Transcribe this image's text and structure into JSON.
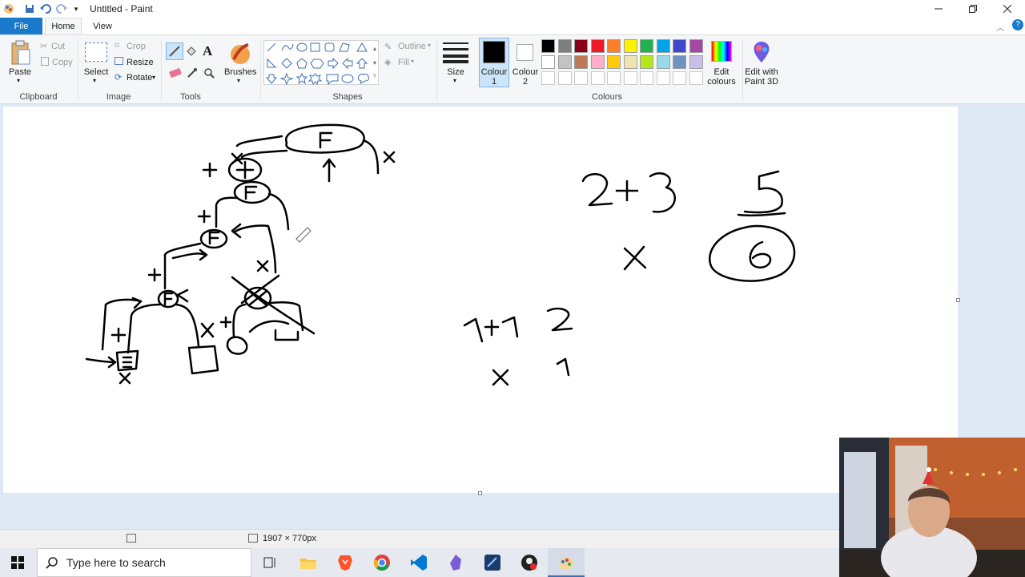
{
  "window": {
    "title": "Untitled - Paint",
    "controls": [
      "minimize",
      "restore",
      "close"
    ]
  },
  "quick_access": [
    "save-icon",
    "undo-icon",
    "redo-icon",
    "customize-icon"
  ],
  "tabs": [
    {
      "label": "File",
      "active": false
    },
    {
      "label": "Home",
      "active": true
    },
    {
      "label": "View",
      "active": false
    }
  ],
  "ribbon": {
    "clipboard": {
      "group": "Clipboard",
      "paste": "Paste",
      "cut": "Cut",
      "copy": "Copy"
    },
    "image": {
      "group": "Image",
      "select": "Select",
      "crop": "Crop",
      "resize": "Resize",
      "rotate": "Rotate"
    },
    "tools": {
      "group": "Tools"
    },
    "brushes": {
      "label": "Brushes"
    },
    "shapes": {
      "group": "Shapes",
      "outline": "Outline",
      "fill": "Fill"
    },
    "size": {
      "label": "Size"
    },
    "colour1": {
      "label": "Colour 1",
      "value": "#000000"
    },
    "colour2": {
      "label": "Colour 2",
      "value": "#ffffff"
    },
    "colours": {
      "group": "Colours",
      "edit": "Edit colours"
    },
    "paint3d": {
      "label": "Edit with Paint 3D"
    }
  },
  "palette_row1": [
    "#000000",
    "#7f7f7f",
    "#880015",
    "#ed1c24",
    "#ff7f27",
    "#fff200",
    "#22b14c",
    "#00a2e8",
    "#3f48cc",
    "#a349a4"
  ],
  "palette_row2": [
    "#ffffff",
    "#c3c3c3",
    "#b97a57",
    "#ffaec9",
    "#ffc90e",
    "#efe4b0",
    "#b5e61d",
    "#99d9ea",
    "#7092be",
    "#c8bfe7"
  ],
  "status": {
    "dimensions": "1907 × 770px"
  },
  "taskbar": {
    "search_placeholder": "Type here to search",
    "apps": [
      "task-view-icon",
      "file-explorer-icon",
      "brave-icon",
      "chrome-icon",
      "vscode-icon",
      "obsidian-icon",
      "app-icon",
      "app-icon",
      "paint-icon"
    ]
  }
}
